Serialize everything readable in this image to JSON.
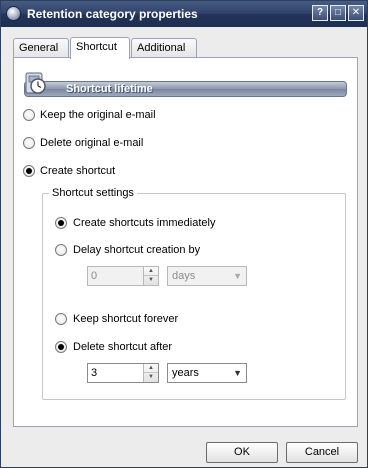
{
  "window": {
    "title": "Retention category properties",
    "title_buttons": {
      "help": "?",
      "maximize": "□",
      "close": "✕"
    }
  },
  "tabs": [
    {
      "label": "General",
      "active": false
    },
    {
      "label": "Shortcut",
      "active": true
    },
    {
      "label": "Additional",
      "active": false
    }
  ],
  "section": {
    "title": "Shortcut lifetime",
    "icon": "shortcut-lifetime-icon"
  },
  "lifetime_options": {
    "keep_original": {
      "label": "Keep the original e-mail",
      "checked": false
    },
    "delete_original": {
      "label": "Delete original e-mail",
      "checked": false
    },
    "create_shortcut": {
      "label": "Create shortcut",
      "checked": true
    }
  },
  "shortcut_settings": {
    "legend": "Shortcut settings",
    "create_immediately": {
      "label": "Create shortcuts immediately",
      "checked": true
    },
    "delay_creation": {
      "label": "Delay shortcut creation by",
      "checked": false,
      "value": "0",
      "unit": "days",
      "disabled": true
    },
    "keep_forever": {
      "label": "Keep shortcut forever",
      "checked": false
    },
    "delete_after": {
      "label": "Delete shortcut after",
      "checked": true,
      "value": "3",
      "unit": "years",
      "disabled": false
    }
  },
  "footer": {
    "ok_label": "OK",
    "cancel_label": "Cancel"
  },
  "colors": {
    "titlebar": "#2f4169",
    "section_header": "#8c97ae",
    "panel": "#ffffff",
    "window_bg": "#ececec"
  }
}
